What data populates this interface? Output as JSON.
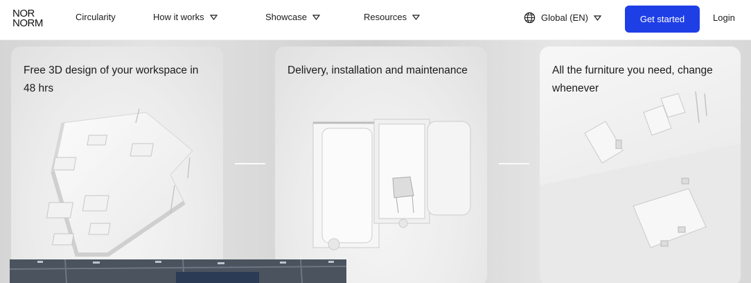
{
  "header": {
    "logo_line1": "NOR",
    "logo_line2": "NORM",
    "nav": [
      {
        "label": "Circularity",
        "has_dropdown": false
      },
      {
        "label": "How it works",
        "has_dropdown": true
      },
      {
        "label": "Showcase",
        "has_dropdown": true
      },
      {
        "label": "Resources",
        "has_dropdown": true
      }
    ],
    "locale_label": "Global (EN)",
    "locale_icon": "globe-icon",
    "cta_label": "Get started",
    "login_label": "Login"
  },
  "steps": [
    {
      "title": "Free 3D design of your workspace in 48 hrs",
      "illustration": "office-floorplan"
    },
    {
      "title": "Delivery, installation and maintenance",
      "illustration": "furniture-crates"
    },
    {
      "title": "All the furniture you need, change whenever",
      "illustration": "desks-arrangement"
    }
  ],
  "colors": {
    "accent": "#1f3fe6",
    "text": "#1a1a1a",
    "background": "#ffffff"
  }
}
